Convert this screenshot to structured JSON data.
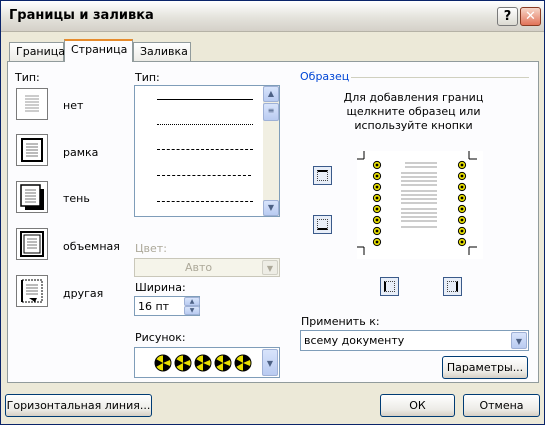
{
  "dialog": {
    "title": "Границы и заливка",
    "help_label": "?",
    "close_label": "✕"
  },
  "tabs": [
    {
      "label": "Граница"
    },
    {
      "label": "Страница"
    },
    {
      "label": "Заливка"
    }
  ],
  "settings": {
    "label": "Тип:",
    "items": [
      {
        "label": "нет"
      },
      {
        "label": "рамка"
      },
      {
        "label": "тень"
      },
      {
        "label": "объемная"
      },
      {
        "label": "другая"
      }
    ]
  },
  "style": {
    "label": "Тип:"
  },
  "color": {
    "label": "Цвет:",
    "value": "Авто"
  },
  "width": {
    "label": "Ширина:",
    "value": "16 пт"
  },
  "art": {
    "label": "Рисунок:"
  },
  "preview": {
    "label": "Образец",
    "instructions": [
      "Для добавления границ",
      "щелкните образец или",
      "используйте кнопки"
    ]
  },
  "apply_to": {
    "label": "Применить к:",
    "value": "всему документу"
  },
  "buttons": {
    "options": "Параметры...",
    "horizontal_line": "Горизонтальная линия...",
    "ok": "ОК",
    "cancel": "Отмена"
  }
}
